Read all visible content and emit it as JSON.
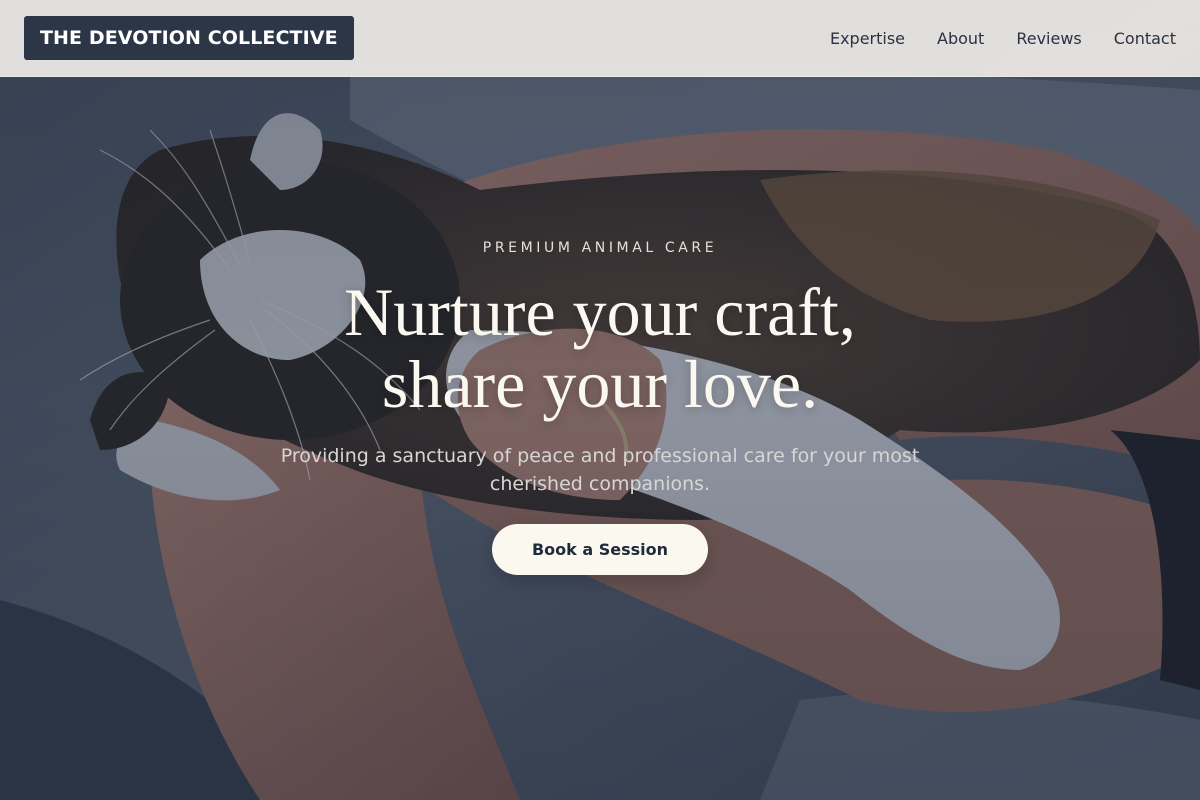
{
  "header": {
    "brand": "THE DEVOTION COLLECTIVE",
    "nav": [
      {
        "label": "Expertise"
      },
      {
        "label": "About"
      },
      {
        "label": "Reviews"
      },
      {
        "label": "Contact"
      }
    ]
  },
  "hero": {
    "eyebrow": "PREMIUM ANIMAL CARE",
    "title_line1": "Nurture your craft,",
    "title_line2": "share your love.",
    "subtitle": "Providing a sanctuary of peace and professional care for your most cherished companions.",
    "cta_label": "Book a Session"
  },
  "colors": {
    "header_bg": "#ECE9E6",
    "brand_bg": "#2C3646",
    "overlay": "#1E2638",
    "title_text": "#FBF8F1",
    "cta_bg": "#FBF8EF",
    "cta_text": "#1F2A3A"
  }
}
